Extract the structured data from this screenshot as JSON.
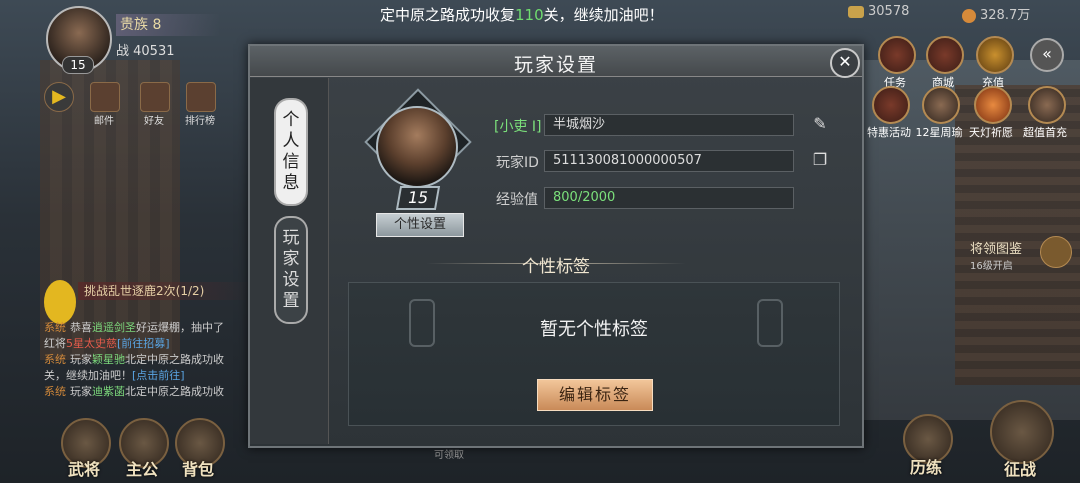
{
  "ticker": {
    "prefix": "定中原之路成功收复",
    "number": "110",
    "suffix": "关，继续加油吧！"
  },
  "player": {
    "level": "15",
    "rank": "贵族 8",
    "power": "战 40531"
  },
  "resources": {
    "gold": "30578",
    "coins": "328.7万"
  },
  "top_right_row1": [
    {
      "label": "任务",
      "icon": "scroll-icon"
    },
    {
      "label": "商城",
      "icon": "shop-icon"
    },
    {
      "label": "充值",
      "icon": "treasure-icon"
    }
  ],
  "top_right_row2": [
    {
      "label": "特惠活动",
      "icon": "gift-icon"
    },
    {
      "label": "12星周瑜",
      "icon": "hero-icon"
    },
    {
      "label": "天灯祈愿",
      "icon": "lantern-icon"
    },
    {
      "label": "超值首充",
      "icon": "hero-icon"
    }
  ],
  "left_menu": [
    {
      "label": "",
      "icon": "arrow-icon"
    },
    {
      "label": "邮件",
      "icon": "mail-icon"
    },
    {
      "label": "好友",
      "icon": "friends-icon"
    },
    {
      "label": "排行榜",
      "icon": "ranking-icon"
    }
  ],
  "challenge": "挑战乱世逐鹿2次(1/2)",
  "chat": [
    {
      "tag": "系统",
      "text1": "恭喜",
      "name": "逍遥剑圣",
      "text2": "好运爆棚，抽中了",
      "line2a": "红将",
      "hero": "5星太史慈",
      "link": "[前往招募]"
    },
    {
      "tag": "系统",
      "text1": "玩家",
      "name": "颖星驰",
      "text2": "北定中原之路成功收",
      "line2a": "关，继续加油吧！",
      "link": "[点击前往]"
    },
    {
      "tag": "系统",
      "text1": "玩家",
      "name": "迪紫菡",
      "text2": "北定中原之路成功收"
    }
  ],
  "bottom_left": [
    {
      "label": "武将",
      "icon": "general-icon"
    },
    {
      "label": "主公",
      "icon": "lord-icon"
    },
    {
      "label": "背包",
      "icon": "bag-icon"
    }
  ],
  "bottom_right": [
    {
      "label": "历练",
      "icon": "training-icon"
    },
    {
      "label": "征战",
      "icon": "battle-horn-icon"
    }
  ],
  "gallery": {
    "title": "将领图鉴",
    "sub": "16级开启"
  },
  "receive_hint": "可领取",
  "modal": {
    "title": "玩家设置",
    "tabs": [
      {
        "label": "个\n人\n信\n息",
        "active": true
      },
      {
        "label": "玩\n家\n设\n置",
        "active": false
      }
    ],
    "profile": {
      "level": "15",
      "settings_button": "个性设置",
      "rank_tag": "[小吏 I]",
      "name": "半城烟沙",
      "id_label": "玩家ID",
      "id_value": "511130081000000507",
      "exp_label": "经验值",
      "exp_value": "800/2000"
    },
    "tags": {
      "heading": "个性标签",
      "empty": "暂无个性标签",
      "edit_button": "编辑标签"
    }
  }
}
